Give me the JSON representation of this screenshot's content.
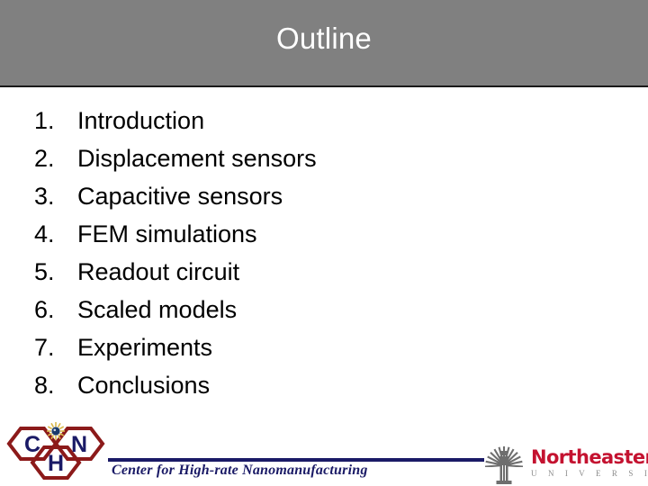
{
  "slide": {
    "title": "Outline",
    "title_bar_color": "#808080",
    "title_text_color": "#ffffff",
    "background_color": "#ffffff",
    "body_text_color": "#000000"
  },
  "outline": {
    "items": [
      {
        "number": "1.",
        "label": "Introduction"
      },
      {
        "number": "2.",
        "label": "Displacement sensors"
      },
      {
        "number": "3.",
        "label": "Capacitive sensors"
      },
      {
        "number": "4.",
        "label": "FEM simulations"
      },
      {
        "number": "5.",
        "label": "Readout circuit"
      },
      {
        "number": "6.",
        "label": "Scaled models"
      },
      {
        "number": "7.",
        "label": "Experiments"
      },
      {
        "number": "8.",
        "label": "Conclusions"
      }
    ]
  },
  "footer": {
    "chn_logo": {
      "icon": "chn-hexagon-logo",
      "letters": [
        "C",
        "H",
        "N"
      ],
      "hex_outline_color": "#8c1a1a",
      "letter_color": "#1a1a66",
      "sunburst_color": "#d9b84c",
      "sunburst_center_color": "#1a3a6b"
    },
    "center_text": "Center for High-rate Nanomanufacturing",
    "center_text_color": "#1a1a66",
    "rule_color": "#1a1a66",
    "northeastern": {
      "seal_icon": "northeastern-seal-icon",
      "name": "Northeastern",
      "subtitle": "U N I V E R S I T Y",
      "name_color": "#c41230",
      "subtitle_color": "#8c8c8c",
      "seal_color": "#6e6e6e"
    }
  }
}
